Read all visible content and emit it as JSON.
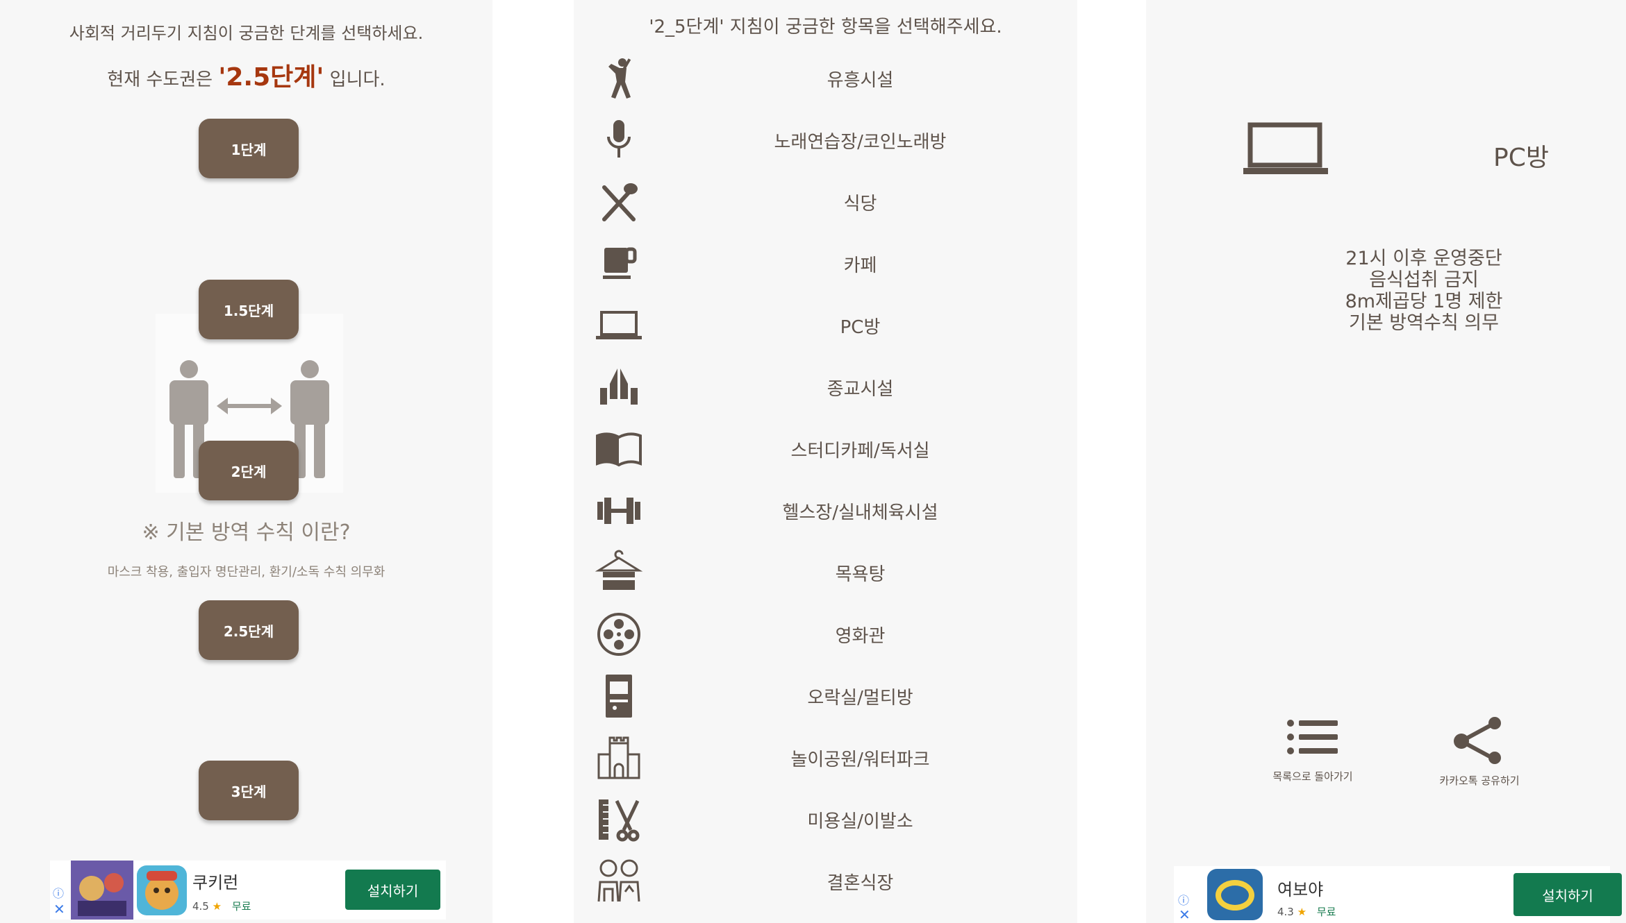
{
  "panel1": {
    "title": "사회적 거리두기 지침이 궁금한 단계를 선택하세요.",
    "current_prefix": "현재 수도권은",
    "current_level": "'2.5단계'",
    "current_suffix": "입니다.",
    "stages": [
      "1단계",
      "1.5단계",
      "2단계",
      "2.5단계",
      "3단계"
    ],
    "question": "※ 기본 방역 수칙 이란?",
    "question_desc": "마스크 착용, 출입자 명단관리, 환기/소독 수칙 의무화",
    "ad": {
      "title": "쿠키런",
      "rating": "4.5",
      "price": "무료",
      "install": "설치하기"
    }
  },
  "panel2": {
    "title": "'2_5단계' 지침이 궁금한 항목을 선택해주세요.",
    "categories": [
      {
        "label": "유흥시설",
        "icon": "dancer-icon"
      },
      {
        "label": "노래연습장/코인노래방",
        "icon": "microphone-icon"
      },
      {
        "label": "식당",
        "icon": "utensils-icon"
      },
      {
        "label": "카페",
        "icon": "coffee-cup-icon"
      },
      {
        "label": "PC방",
        "icon": "laptop-icon"
      },
      {
        "label": "종교시설",
        "icon": "praying-hands-icon"
      },
      {
        "label": "스터디카페/독서실",
        "icon": "book-icon"
      },
      {
        "label": "헬스장/실내체육시설",
        "icon": "dumbbell-icon"
      },
      {
        "label": "목욕탕",
        "icon": "towel-hanger-icon"
      },
      {
        "label": "영화관",
        "icon": "film-reel-icon"
      },
      {
        "label": "오락실/멀티방",
        "icon": "arcade-icon"
      },
      {
        "label": "놀이공원/워터파크",
        "icon": "castle-icon"
      },
      {
        "label": "미용실/이발소",
        "icon": "scissors-comb-icon"
      },
      {
        "label": "결혼식장",
        "icon": "couple-icon"
      }
    ]
  },
  "panel3": {
    "title": "PC방",
    "icon": "laptop-icon",
    "rules": [
      "21시 이후 운영중단",
      "음식섭취 금지",
      "8m제곱당 1명 제한",
      "기본 방역수칙 의무"
    ],
    "back_label": "목록으로 돌아가기",
    "share_label": "카카오톡 공유하기",
    "ad": {
      "title": "여보야",
      "rating": "4.3",
      "price": "무료",
      "install": "설치하기"
    }
  },
  "colors": {
    "brown": "#735f4f",
    "text": "#5e534b",
    "highlight": "#a6370f",
    "install_green": "#137a4f"
  }
}
